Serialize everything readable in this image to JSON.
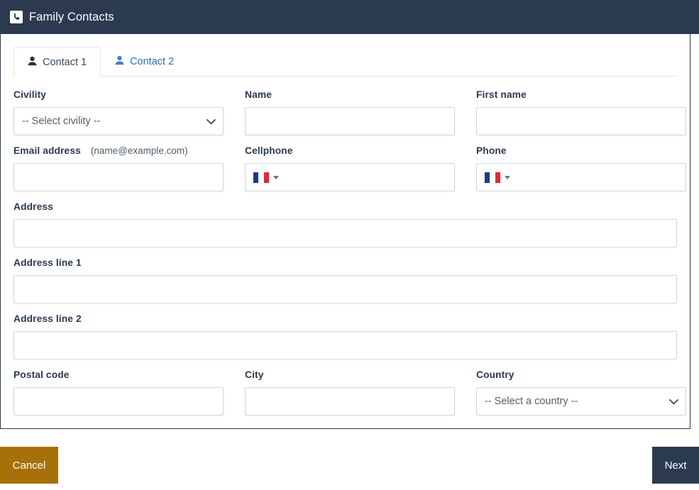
{
  "header": {
    "title": "Family Contacts",
    "icon": "phone-icon"
  },
  "tabs": [
    {
      "label": "Contact 1",
      "icon": "user-icon",
      "active": true
    },
    {
      "label": "Contact 2",
      "icon": "user-icon",
      "active": false
    }
  ],
  "form": {
    "civility": {
      "label": "Civility",
      "selected": "-- Select civility --",
      "options": [
        "-- Select civility --"
      ]
    },
    "name": {
      "label": "Name",
      "value": "",
      "placeholder": ""
    },
    "first_name": {
      "label": "First name",
      "value": "",
      "placeholder": ""
    },
    "email": {
      "label": "Email address",
      "hint": "(name@example.com)",
      "value": "",
      "placeholder": ""
    },
    "cellphone": {
      "label": "Cellphone",
      "value": "",
      "placeholder": "",
      "country_flag": "france-flag-icon"
    },
    "phone": {
      "label": "Phone",
      "value": "",
      "placeholder": "",
      "country_flag": "france-flag-icon"
    },
    "address": {
      "label": "Address",
      "value": "",
      "placeholder": ""
    },
    "address_line_1": {
      "label": "Address line 1",
      "value": "",
      "placeholder": ""
    },
    "address_line_2": {
      "label": "Address line 2",
      "value": "",
      "placeholder": ""
    },
    "postal_code": {
      "label": "Postal code",
      "value": "",
      "placeholder": ""
    },
    "city": {
      "label": "City",
      "value": "",
      "placeholder": ""
    },
    "country": {
      "label": "Country",
      "selected": "-- Select a country --",
      "options": [
        "-- Select a country --"
      ]
    }
  },
  "footer": {
    "cancel_label": "Cancel",
    "next_label": "Next"
  },
  "colors": {
    "header_bg": "#2b3a4f",
    "cancel_bg": "#a8700a",
    "next_bg": "#2b3a4f",
    "tab_inactive_text": "#2f6fb0",
    "field_border": "#ced4da"
  }
}
